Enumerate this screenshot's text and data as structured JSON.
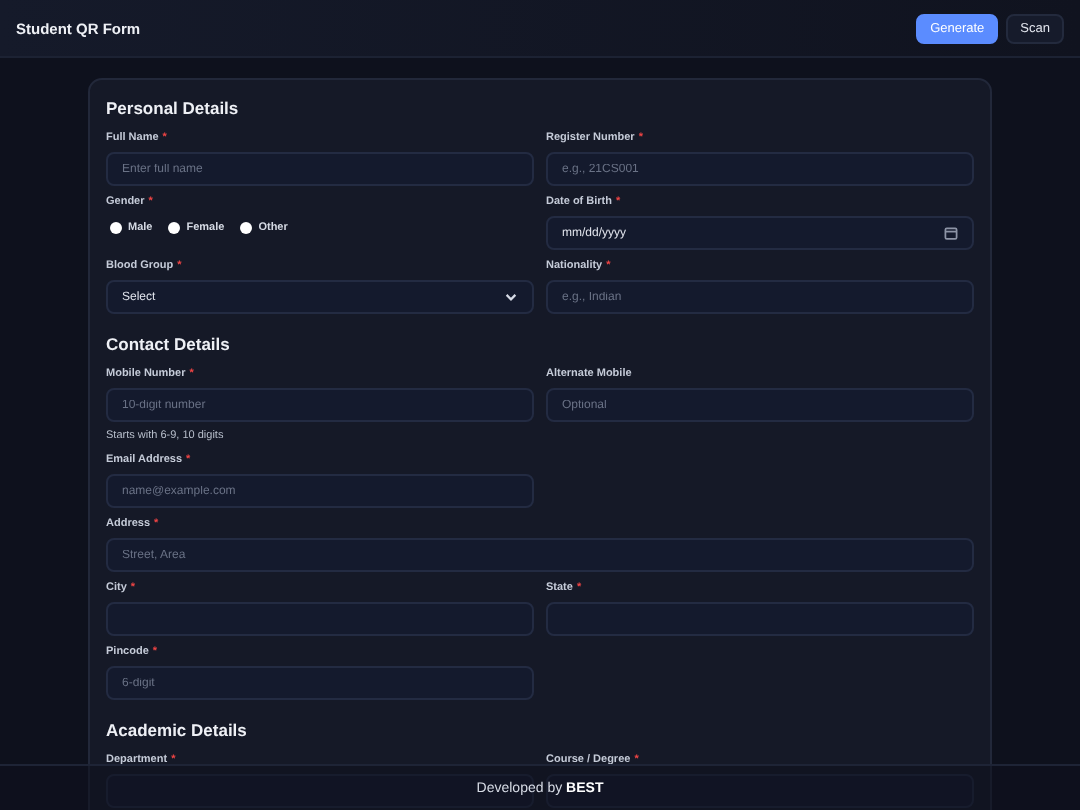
{
  "header": {
    "title": "Student QR Form",
    "buttons": [
      {
        "label": "Generate",
        "selected": true
      },
      {
        "label": "Scan",
        "selected": false
      }
    ]
  },
  "sections": [
    {
      "title": "Personal Details",
      "fields": [
        {
          "kind": "text",
          "label": "Full Name",
          "required_mark": "*",
          "placeholder": "Enter full name"
        },
        {
          "kind": "text",
          "label": "Register Number",
          "required_mark": "*",
          "placeholder": "e.g., 21CS001"
        },
        {
          "kind": "radio",
          "label": "Gender",
          "required_mark": "*",
          "options": [
            {
              "label": "Male",
              "selected": false
            },
            {
              "label": "Female",
              "selected": false
            },
            {
              "label": "Other",
              "selected": false
            }
          ]
        },
        {
          "kind": "date",
          "label": "Date of Birth",
          "required_mark": "*",
          "value": "mm/dd/yyyy"
        },
        {
          "kind": "select",
          "label": "Blood Group",
          "required_mark": "*",
          "value": "Select"
        },
        {
          "kind": "text",
          "label": "Nationality",
          "required_mark": "*",
          "placeholder": "e.g., Indian"
        }
      ]
    },
    {
      "title": "Contact Details",
      "fields": [
        {
          "kind": "text",
          "label": "Mobile Number",
          "required_mark": "*",
          "placeholder": "10-digit number",
          "hint": "Starts with 6-9, 10 digits"
        },
        {
          "kind": "text",
          "label": "Alternate Mobile",
          "placeholder": "Optional"
        },
        {
          "kind": "text",
          "label": "Email Address",
          "required_mark": "*",
          "placeholder": "name@example.com",
          "wide": false
        },
        {
          "kind": "text",
          "label": "Address",
          "required_mark": "*",
          "placeholder": "Street, Area",
          "wide": true
        },
        {
          "kind": "text",
          "label": "City",
          "required_mark": "*"
        },
        {
          "kind": "text",
          "label": "State",
          "required_mark": "*"
        },
        {
          "kind": "text",
          "label": "Pincode",
          "required_mark": "*",
          "placeholder": "6-digit"
        }
      ]
    },
    {
      "title": "Academic Details",
      "fields": [
        {
          "kind": "text",
          "label": "Department",
          "required_mark": "*"
        },
        {
          "kind": "text",
          "label": "Course / Degree",
          "required_mark": "*"
        }
      ]
    }
  ],
  "footer": {
    "text": "Developed by **BEST**"
  }
}
